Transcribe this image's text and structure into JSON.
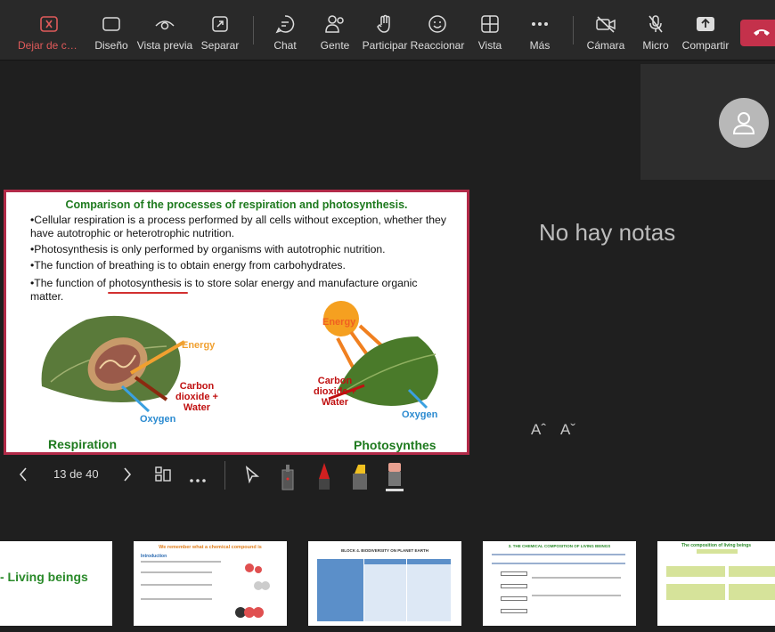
{
  "toolbar": {
    "items": [
      {
        "label": "Dejar de co...",
        "icon": "close-box-icon"
      },
      {
        "label": "Diseño",
        "icon": "layout-icon"
      },
      {
        "label": "Vista previa",
        "icon": "eye-icon"
      },
      {
        "label": "Separar",
        "icon": "popout-icon"
      },
      {
        "label": "Chat",
        "icon": "chat-icon"
      },
      {
        "label": "Gente",
        "icon": "people-icon"
      },
      {
        "label": "Participar",
        "icon": "hand-icon"
      },
      {
        "label": "Reaccionar",
        "icon": "smiley-icon"
      },
      {
        "label": "Vista",
        "icon": "grid-icon"
      },
      {
        "label": "Más",
        "icon": "more-icon"
      },
      {
        "label": "Cámara",
        "icon": "camera-off-icon"
      },
      {
        "label": "Micro",
        "icon": "mic-off-icon"
      },
      {
        "label": "Compartir",
        "icon": "share-icon"
      }
    ],
    "hangup_color": "#c4314b"
  },
  "notes": {
    "text": "No hay notas"
  },
  "font_controls": {
    "increase": "Aˆ",
    "decrease": "Aˇ"
  },
  "slide": {
    "title": "Comparison of the processes of respiration and photosynthesis.",
    "bullets": [
      "•Cellular respiration is a process performed by all cells without exception, whether they have autotrophic or heterotrophic nutrition.",
      "•Photosynthesis is only performed by organisms with autotrophic nutrition.",
      "•The function of breathing is to obtain energy from carbohydrates.",
      "•The function of photosynthesis is to store solar energy and manufacture organic matter."
    ],
    "left_labels": {
      "energy": "Energy",
      "carbon": "Carbon dioxide + Water",
      "oxygen": "Oxygen"
    },
    "right_labels": {
      "energy": "Energy",
      "carbon": "Carbon dioxide + Water",
      "oxygen": "Oxygen"
    },
    "respiration": "Respiration",
    "photosynthesis": "Photosynthes"
  },
  "presenter": {
    "counter": "13 de 40"
  },
  "thumbnails": {
    "t1": "- Living beings",
    "t2_title": "We remember what a chemical compound is",
    "t2_sub": "Introduction",
    "t3_title": "BLOCK 4. BIODIVERSITY ON PLANET EARTH",
    "t4_title": "3. THE CHEMICAL COMPOSITION OF LIVING BEINGS",
    "t5_title": "The composition of living beings"
  }
}
